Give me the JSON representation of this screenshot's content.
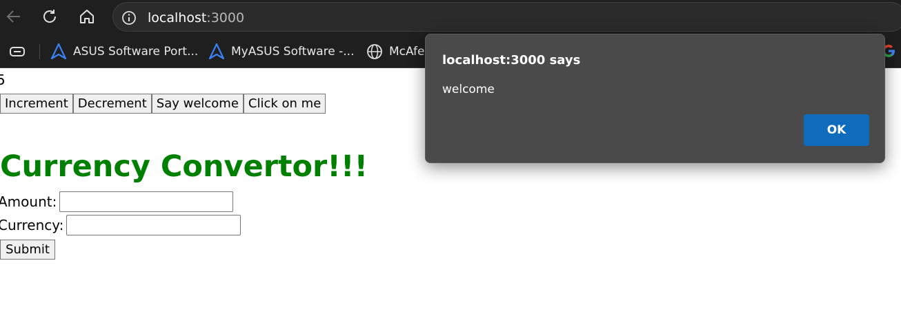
{
  "browser": {
    "url_host": "localhost",
    "url_port": ":3000",
    "bookmarks": [
      {
        "icon": "asus-icon",
        "label": "ASUS Software Port..."
      },
      {
        "icon": "asus-icon",
        "label": "MyASUS Software -..."
      },
      {
        "icon": "globe-icon",
        "label": "McAfe"
      }
    ]
  },
  "page": {
    "count": "5",
    "buttons": {
      "increment": "Increment",
      "decrement": "Decrement",
      "say_welcome": "Say welcome",
      "click_on_me": "Click on me"
    },
    "heading": "Currency Convertor!!!",
    "heading_color": "#008000",
    "form": {
      "amount_label": "Amount:",
      "amount_value": "",
      "currency_label": "Currency:",
      "currency_value": "",
      "submit_label": "Submit"
    }
  },
  "dialog": {
    "title": "localhost:3000 says",
    "message": "welcome",
    "ok_label": "OK",
    "ok_color": "#0f6cbd"
  }
}
